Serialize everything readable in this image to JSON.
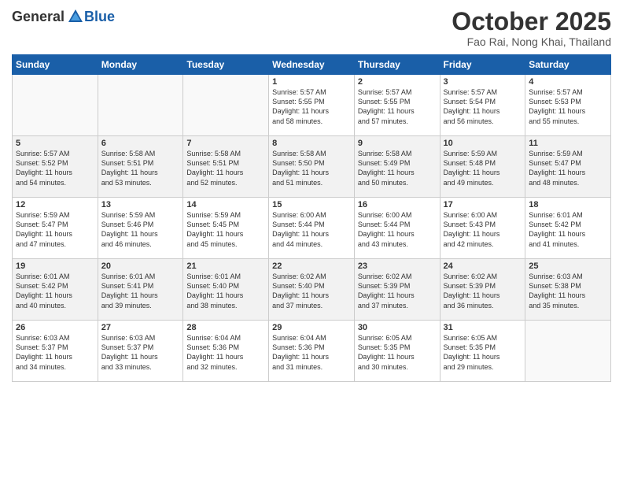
{
  "header": {
    "logo_general": "General",
    "logo_blue": "Blue",
    "month_title": "October 2025",
    "location": "Fao Rai, Nong Khai, Thailand"
  },
  "weekdays": [
    "Sunday",
    "Monday",
    "Tuesday",
    "Wednesday",
    "Thursday",
    "Friday",
    "Saturday"
  ],
  "weeks": [
    [
      {
        "day": "",
        "text": ""
      },
      {
        "day": "",
        "text": ""
      },
      {
        "day": "",
        "text": ""
      },
      {
        "day": "1",
        "text": "Sunrise: 5:57 AM\nSunset: 5:55 PM\nDaylight: 11 hours\nand 58 minutes."
      },
      {
        "day": "2",
        "text": "Sunrise: 5:57 AM\nSunset: 5:55 PM\nDaylight: 11 hours\nand 57 minutes."
      },
      {
        "day": "3",
        "text": "Sunrise: 5:57 AM\nSunset: 5:54 PM\nDaylight: 11 hours\nand 56 minutes."
      },
      {
        "day": "4",
        "text": "Sunrise: 5:57 AM\nSunset: 5:53 PM\nDaylight: 11 hours\nand 55 minutes."
      }
    ],
    [
      {
        "day": "5",
        "text": "Sunrise: 5:57 AM\nSunset: 5:52 PM\nDaylight: 11 hours\nand 54 minutes."
      },
      {
        "day": "6",
        "text": "Sunrise: 5:58 AM\nSunset: 5:51 PM\nDaylight: 11 hours\nand 53 minutes."
      },
      {
        "day": "7",
        "text": "Sunrise: 5:58 AM\nSunset: 5:51 PM\nDaylight: 11 hours\nand 52 minutes."
      },
      {
        "day": "8",
        "text": "Sunrise: 5:58 AM\nSunset: 5:50 PM\nDaylight: 11 hours\nand 51 minutes."
      },
      {
        "day": "9",
        "text": "Sunrise: 5:58 AM\nSunset: 5:49 PM\nDaylight: 11 hours\nand 50 minutes."
      },
      {
        "day": "10",
        "text": "Sunrise: 5:59 AM\nSunset: 5:48 PM\nDaylight: 11 hours\nand 49 minutes."
      },
      {
        "day": "11",
        "text": "Sunrise: 5:59 AM\nSunset: 5:47 PM\nDaylight: 11 hours\nand 48 minutes."
      }
    ],
    [
      {
        "day": "12",
        "text": "Sunrise: 5:59 AM\nSunset: 5:47 PM\nDaylight: 11 hours\nand 47 minutes."
      },
      {
        "day": "13",
        "text": "Sunrise: 5:59 AM\nSunset: 5:46 PM\nDaylight: 11 hours\nand 46 minutes."
      },
      {
        "day": "14",
        "text": "Sunrise: 5:59 AM\nSunset: 5:45 PM\nDaylight: 11 hours\nand 45 minutes."
      },
      {
        "day": "15",
        "text": "Sunrise: 6:00 AM\nSunset: 5:44 PM\nDaylight: 11 hours\nand 44 minutes."
      },
      {
        "day": "16",
        "text": "Sunrise: 6:00 AM\nSunset: 5:44 PM\nDaylight: 11 hours\nand 43 minutes."
      },
      {
        "day": "17",
        "text": "Sunrise: 6:00 AM\nSunset: 5:43 PM\nDaylight: 11 hours\nand 42 minutes."
      },
      {
        "day": "18",
        "text": "Sunrise: 6:01 AM\nSunset: 5:42 PM\nDaylight: 11 hours\nand 41 minutes."
      }
    ],
    [
      {
        "day": "19",
        "text": "Sunrise: 6:01 AM\nSunset: 5:42 PM\nDaylight: 11 hours\nand 40 minutes."
      },
      {
        "day": "20",
        "text": "Sunrise: 6:01 AM\nSunset: 5:41 PM\nDaylight: 11 hours\nand 39 minutes."
      },
      {
        "day": "21",
        "text": "Sunrise: 6:01 AM\nSunset: 5:40 PM\nDaylight: 11 hours\nand 38 minutes."
      },
      {
        "day": "22",
        "text": "Sunrise: 6:02 AM\nSunset: 5:40 PM\nDaylight: 11 hours\nand 37 minutes."
      },
      {
        "day": "23",
        "text": "Sunrise: 6:02 AM\nSunset: 5:39 PM\nDaylight: 11 hours\nand 37 minutes."
      },
      {
        "day": "24",
        "text": "Sunrise: 6:02 AM\nSunset: 5:39 PM\nDaylight: 11 hours\nand 36 minutes."
      },
      {
        "day": "25",
        "text": "Sunrise: 6:03 AM\nSunset: 5:38 PM\nDaylight: 11 hours\nand 35 minutes."
      }
    ],
    [
      {
        "day": "26",
        "text": "Sunrise: 6:03 AM\nSunset: 5:37 PM\nDaylight: 11 hours\nand 34 minutes."
      },
      {
        "day": "27",
        "text": "Sunrise: 6:03 AM\nSunset: 5:37 PM\nDaylight: 11 hours\nand 33 minutes."
      },
      {
        "day": "28",
        "text": "Sunrise: 6:04 AM\nSunset: 5:36 PM\nDaylight: 11 hours\nand 32 minutes."
      },
      {
        "day": "29",
        "text": "Sunrise: 6:04 AM\nSunset: 5:36 PM\nDaylight: 11 hours\nand 31 minutes."
      },
      {
        "day": "30",
        "text": "Sunrise: 6:05 AM\nSunset: 5:35 PM\nDaylight: 11 hours\nand 30 minutes."
      },
      {
        "day": "31",
        "text": "Sunrise: 6:05 AM\nSunset: 5:35 PM\nDaylight: 11 hours\nand 29 minutes."
      },
      {
        "day": "",
        "text": ""
      }
    ]
  ]
}
